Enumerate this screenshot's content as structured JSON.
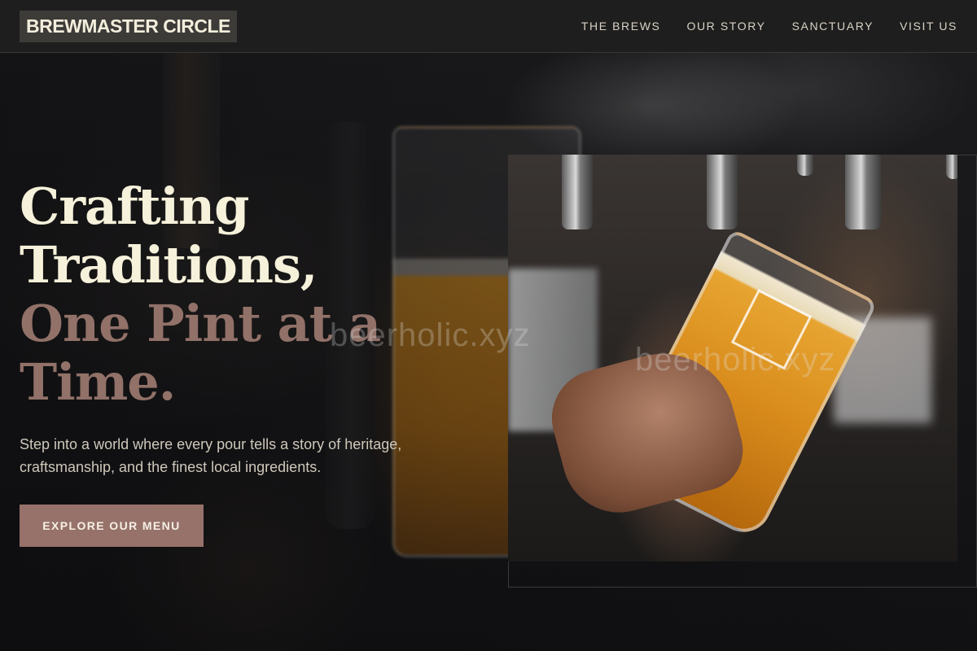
{
  "header": {
    "logo": "BREWMASTER CIRCLE",
    "nav": [
      "THE BREWS",
      "OUR STORY",
      "SANCTUARY",
      "VISIT US"
    ]
  },
  "hero": {
    "title_lines": [
      "Crafting",
      "Traditions,",
      "One Pint at a",
      "Time."
    ],
    "description": "Step into a world where every pour tells a story of heritage, craftsmanship, and the finest local ingredients.",
    "cta": "EXPLORE OUR MENU"
  },
  "watermark": "beerholic.xyz",
  "colors": {
    "accent": "#96726a",
    "title_highlight": "#917168",
    "cream": "#f6f1da",
    "header_bg": "#1f1e1e"
  }
}
